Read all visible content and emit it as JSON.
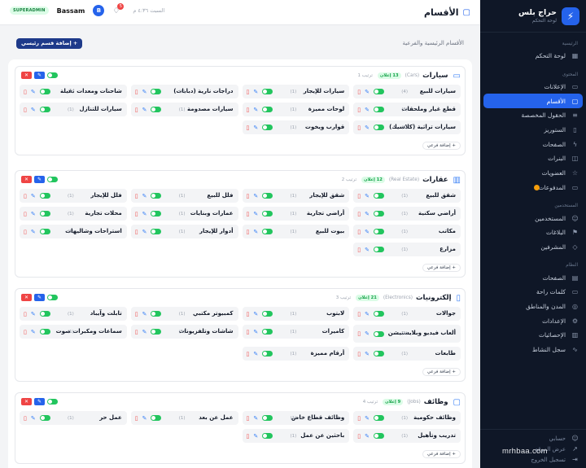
{
  "sidebar": {
    "brand": "حراج بلس",
    "brand_sub": "لوحة التحكم",
    "logo": "⚡",
    "section_main": "الرئيسية",
    "section_content": "المحتوى",
    "section_users": "المستخدمين",
    "section_system": "النظام",
    "items": {
      "dashboard": "لوحة التحكم",
      "ads": "الإعلانات",
      "categories": "الأقسام",
      "custom_fields": "الحقول المخصصة",
      "stories": "الستوريز",
      "pages_ads": "الصفحات",
      "banners": "البنرات",
      "subscriptions": "العضويات",
      "promoted": "المدفوعات",
      "users": "المستخدمين",
      "reports": "البلاغات",
      "supervisors": "المشرفين",
      "pages": "الصفحات",
      "quick_words": "كلمات راحة",
      "cities": "المدن والمناطق",
      "settings": "الإعدادات",
      "stats": "الإحصائيات",
      "activity": "سجل النشاط"
    },
    "bottom": {
      "account": "حسابي",
      "view_site": "عرض الموقع",
      "logout": "تسجيل الخروج"
    }
  },
  "topbar": {
    "title": "الأقسام",
    "role": "SUPERADMIN",
    "user": "Bassam",
    "avatar": "B",
    "bell_count": "5",
    "date": "السبت ٤:٣٦ م"
  },
  "subbar": {
    "text": "الأقسام الرئيسية والفرعية",
    "add_label": "+ إضافة قسم رئيسي"
  },
  "labels": {
    "add_sub": "+ إضافة فرعي"
  },
  "cards": [
    {
      "name": "سيارات",
      "slug": "(Cars)",
      "count": "13 إعلان",
      "order": "ترتيب 1",
      "subs": [
        {
          "name": "سيارات للبيع",
          "count": "(4)"
        },
        {
          "name": "سيارات للإيجار",
          "count": "(1)"
        },
        {
          "name": "دراجات نارية (دبابات)",
          "count": "(1)"
        },
        {
          "name": "شاحنات ومعدات ثقيلة",
          "count": "(1)"
        },
        {
          "name": "قطع غيار وملحقات",
          "count": "(1)"
        },
        {
          "name": "لوحات مميزة",
          "count": "(1)"
        },
        {
          "name": "سيارات مصدومة",
          "count": "(1)"
        },
        {
          "name": "سيارات للتنازل",
          "count": "(1)"
        },
        {
          "name": "سيارات تراثية (كلاسيك)",
          "count": "(1)"
        },
        {
          "name": "قوارب ويخوت",
          "count": "(1)"
        }
      ]
    },
    {
      "name": "عقارات",
      "slug": "(Real Estate)",
      "count": "12 إعلان",
      "order": "ترتيب 2",
      "subs": [
        {
          "name": "شقق للبيع",
          "count": "(1)"
        },
        {
          "name": "شقق للإيجار",
          "count": "(1)"
        },
        {
          "name": "فلل للبيع",
          "count": "(1)"
        },
        {
          "name": "فلل للإيجار",
          "count": "(1)"
        },
        {
          "name": "أراضي سكنية",
          "count": "(1)"
        },
        {
          "name": "أراضي تجارية",
          "count": "(1)"
        },
        {
          "name": "عمارات وبنايات",
          "count": "(1)"
        },
        {
          "name": "محلات تجارية",
          "count": "(1)"
        },
        {
          "name": "مكاتب",
          "count": "(1)"
        },
        {
          "name": "بيوت للبيع",
          "count": "(1)"
        },
        {
          "name": "أدوار للإيجار",
          "count": "(1)"
        },
        {
          "name": "استراحات وشاليهات",
          "count": "(1)"
        },
        {
          "name": "مزارع",
          "count": "(1)"
        }
      ]
    },
    {
      "name": "إلكترونيات",
      "slug": "(Electronics)",
      "count": "21 إعلان",
      "order": "ترتيب 3",
      "subs": [
        {
          "name": "جوالات",
          "count": "(1)"
        },
        {
          "name": "لابتوب",
          "count": "(1)"
        },
        {
          "name": "كمبيوتر مكتبي",
          "count": "(1)"
        },
        {
          "name": "تابلت وآيباد",
          "count": "(1)"
        },
        {
          "name": "ألعاب فيديو وبلايستيشن",
          "count": "(1)"
        },
        {
          "name": "كاميرات",
          "count": "(1)"
        },
        {
          "name": "شاشات وتلفزيونات",
          "count": "(1)"
        },
        {
          "name": "سماعات ومكبرات صوت",
          "count": "(1)"
        },
        {
          "name": "طابعات",
          "count": "(1)"
        },
        {
          "name": "أرقام مميزة",
          "count": "(1)"
        }
      ]
    },
    {
      "name": "وظائف",
      "slug": "(Jobs)",
      "count": "9 إعلان",
      "order": "ترتيب 4",
      "subs": [
        {
          "name": "وظائف حكومية",
          "count": "(1)"
        },
        {
          "name": "وظائف قطاع خاص",
          "count": "(1)"
        },
        {
          "name": "عمل عن بعد",
          "count": "(1)"
        },
        {
          "name": "عمل حر",
          "count": "(1)"
        },
        {
          "name": "تدريب وتأهيل",
          "count": "(1)"
        },
        {
          "name": "باحثين عن عمل",
          "count": "(1)"
        }
      ]
    }
  ],
  "watermark": "mrhbaa.com"
}
